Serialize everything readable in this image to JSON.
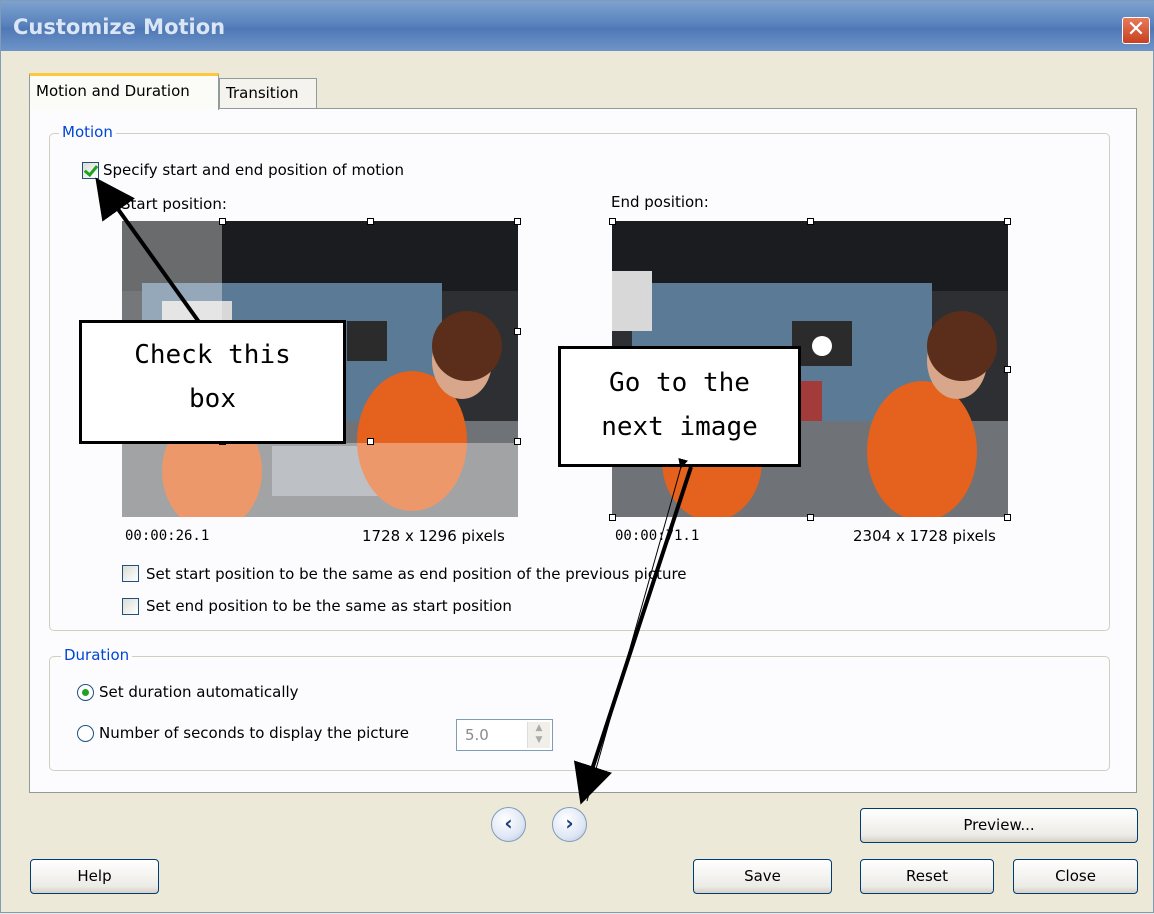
{
  "window": {
    "title": "Customize Motion",
    "close_glyph": "✕"
  },
  "tabs": [
    {
      "label": "Motion and Duration",
      "active": true
    },
    {
      "label": "Transition",
      "active": false
    }
  ],
  "motion": {
    "group_label": "Motion",
    "specify_label": "Specify start and end position of motion",
    "specify_checked": true,
    "start": {
      "label": "Start position:",
      "time": "00:00:26.1",
      "size": "1728 x 1296 pixels"
    },
    "end": {
      "label": "End position:",
      "time": "00:00:71.1",
      "size": "2304 x 1728 pixels"
    },
    "same_as_prev_label": "Set start position to be the same as end position of the previous picture",
    "same_as_prev_checked": false,
    "end_same_as_start_label": "Set end position to be the same as start position",
    "end_same_as_start_checked": false
  },
  "duration": {
    "group_label": "Duration",
    "auto_label": "Set duration automatically",
    "auto_selected": true,
    "seconds_label": "Number of seconds to display the picture",
    "seconds_value": "5.0"
  },
  "nav": {
    "prev_glyph": "‹",
    "next_glyph": "›"
  },
  "buttons": {
    "preview": "Preview...",
    "help": "Help",
    "save": "Save",
    "reset": "Reset",
    "close": "Close"
  },
  "callouts": {
    "check_box": "Check this box",
    "next_image": "Go to the next image"
  },
  "colors": {
    "titlebar": "#5b84be",
    "group_label": "#0046d5",
    "check_mark": "#21a121",
    "close_button": "#c7401f"
  }
}
